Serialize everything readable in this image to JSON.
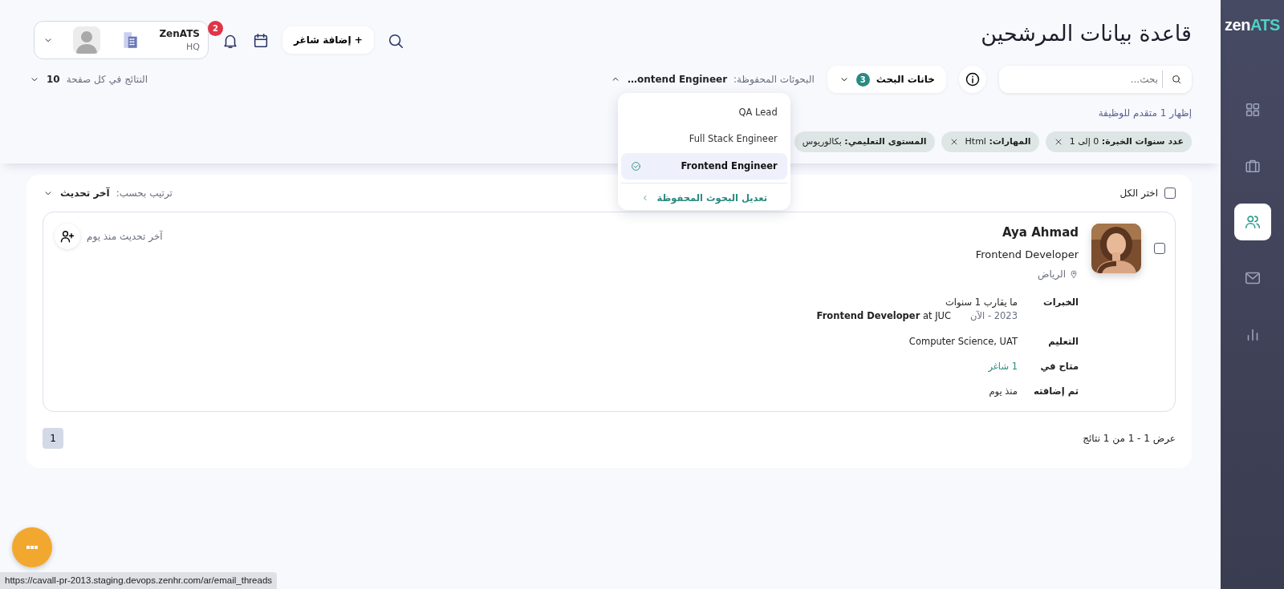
{
  "sidebar": {
    "logo_prefix": "zen",
    "logo_suffix": "ATS",
    "items": [
      {
        "kind": "dashboard",
        "selected": false
      },
      {
        "kind": "jobs",
        "selected": false
      },
      {
        "kind": "candidates",
        "selected": true
      },
      {
        "kind": "mail",
        "selected": false
      },
      {
        "kind": "reports",
        "selected": false
      }
    ]
  },
  "page_title": "قاعدة بيانات المرشحين",
  "header": {
    "add_job_button": "+ إضافة شاغر",
    "notifications_count": "2",
    "account": {
      "name": "ZenATS",
      "branch": "HQ"
    }
  },
  "search": {
    "placeholder": "بحث...",
    "fields_button": {
      "label": "خانات البحث",
      "count": "3"
    }
  },
  "saved_searches": {
    "label": "البحوثات المحفوظة:",
    "current": "ontend Engineer…",
    "expanded": true,
    "options": [
      {
        "label": "QA Lead",
        "selected": false
      },
      {
        "label": "Full Stack Engineer",
        "selected": false
      },
      {
        "label": "Frontend Engineer",
        "selected": true
      }
    ],
    "edit_link": "تعديل البحوث المحفوظة"
  },
  "per_page": {
    "label": "النتائج في كل صفحة",
    "value": "10"
  },
  "results_summary": "إظهار 1 متقدم للوظيفة",
  "filters": [
    {
      "label": "عدد سنوات الخبرة:",
      "value": "0 إلى 1",
      "removable": true
    },
    {
      "label": "المهارات:",
      "value": "Html",
      "removable": true
    },
    {
      "label": "المستوى التعليمي:",
      "value": "بكالوريوس",
      "removable": false
    }
  ],
  "select_all": {
    "label": "اختر الكل",
    "checked": false
  },
  "sort": {
    "label": "ترتيب بحسب:",
    "value": "آخر تحديث"
  },
  "candidates": [
    {
      "name": "Aya Ahmad",
      "title": "Frontend Developer",
      "location": "الرياض",
      "checked": false,
      "updated": "آخر تحديث منذ يوم",
      "details": [
        {
          "kind": "experience",
          "label": "الخبرات",
          "value": "ما يقارب 1 سنوات",
          "period": "2023 - الآن",
          "role": "**Frontend Developer** at JUC"
        },
        {
          "kind": "text",
          "label": "التعليم",
          "value": "Computer Science, UAT"
        },
        {
          "kind": "link",
          "label": "متاح في",
          "value": "1 شاغر"
        },
        {
          "kind": "text",
          "label": "تم إضافته",
          "value": "منذ يوم"
        }
      ]
    }
  ],
  "pagination": {
    "summary": "عرض 1 - 1 من 1 نتائج",
    "pages": [
      {
        "label": "1",
        "selected": true
      }
    ]
  },
  "status_url": "https://cavall-pr-2013.staging.devops.zenhr.com/ar/email_threads"
}
